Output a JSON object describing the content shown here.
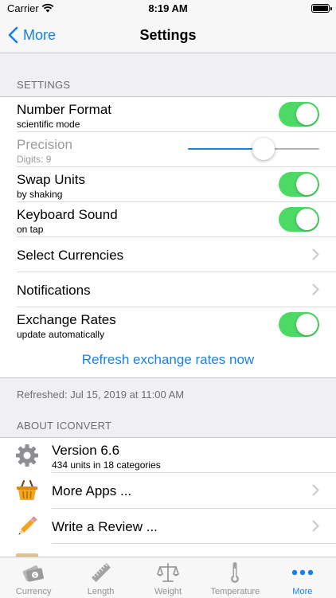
{
  "status_bar": {
    "carrier": "Carrier",
    "time": "8:19 AM"
  },
  "nav": {
    "back_label": "More",
    "title": "Settings"
  },
  "settings_section": {
    "header": "SETTINGS",
    "number_format": {
      "title": "Number Format",
      "subtitle": "scientific mode",
      "on": true
    },
    "precision": {
      "title": "Precision",
      "subtitle": "Digits: 9",
      "slider_fraction": 0.58
    },
    "swap_units": {
      "title": "Swap Units",
      "subtitle": "by shaking",
      "on": true
    },
    "keyboard_sound": {
      "title": "Keyboard Sound",
      "subtitle": "on tap",
      "on": true
    },
    "select_currencies": {
      "title": "Select Currencies"
    },
    "notifications": {
      "title": "Notifications"
    },
    "exchange_rates": {
      "title": "Exchange Rates",
      "subtitle": "update automatically",
      "on": true
    },
    "refresh_link": "Refresh exchange rates now",
    "footer": "Refreshed: Jul 15, 2019 at 11:00 AM"
  },
  "about_section": {
    "header": "ABOUT ICONVERT",
    "version": {
      "title": "Version 6.6",
      "subtitle": "434 units in 18 categories",
      "icon": "gear-icon"
    },
    "more_apps": {
      "title": "More Apps ...",
      "icon": "basket-icon"
    },
    "write_review": {
      "title": "Write a Review ...",
      "icon": "pencil-icon"
    }
  },
  "tab_bar": {
    "tabs": [
      {
        "label": "Currency",
        "icon": "currency-icon"
      },
      {
        "label": "Length",
        "icon": "ruler-icon"
      },
      {
        "label": "Weight",
        "icon": "scale-icon"
      },
      {
        "label": "Temperature",
        "icon": "thermometer-icon"
      },
      {
        "label": "More",
        "icon": "more-dots-icon",
        "active": true
      }
    ]
  },
  "colors": {
    "accent": "#1a80e6",
    "toggle_on": "#4cd964",
    "background": "#efeff4"
  }
}
